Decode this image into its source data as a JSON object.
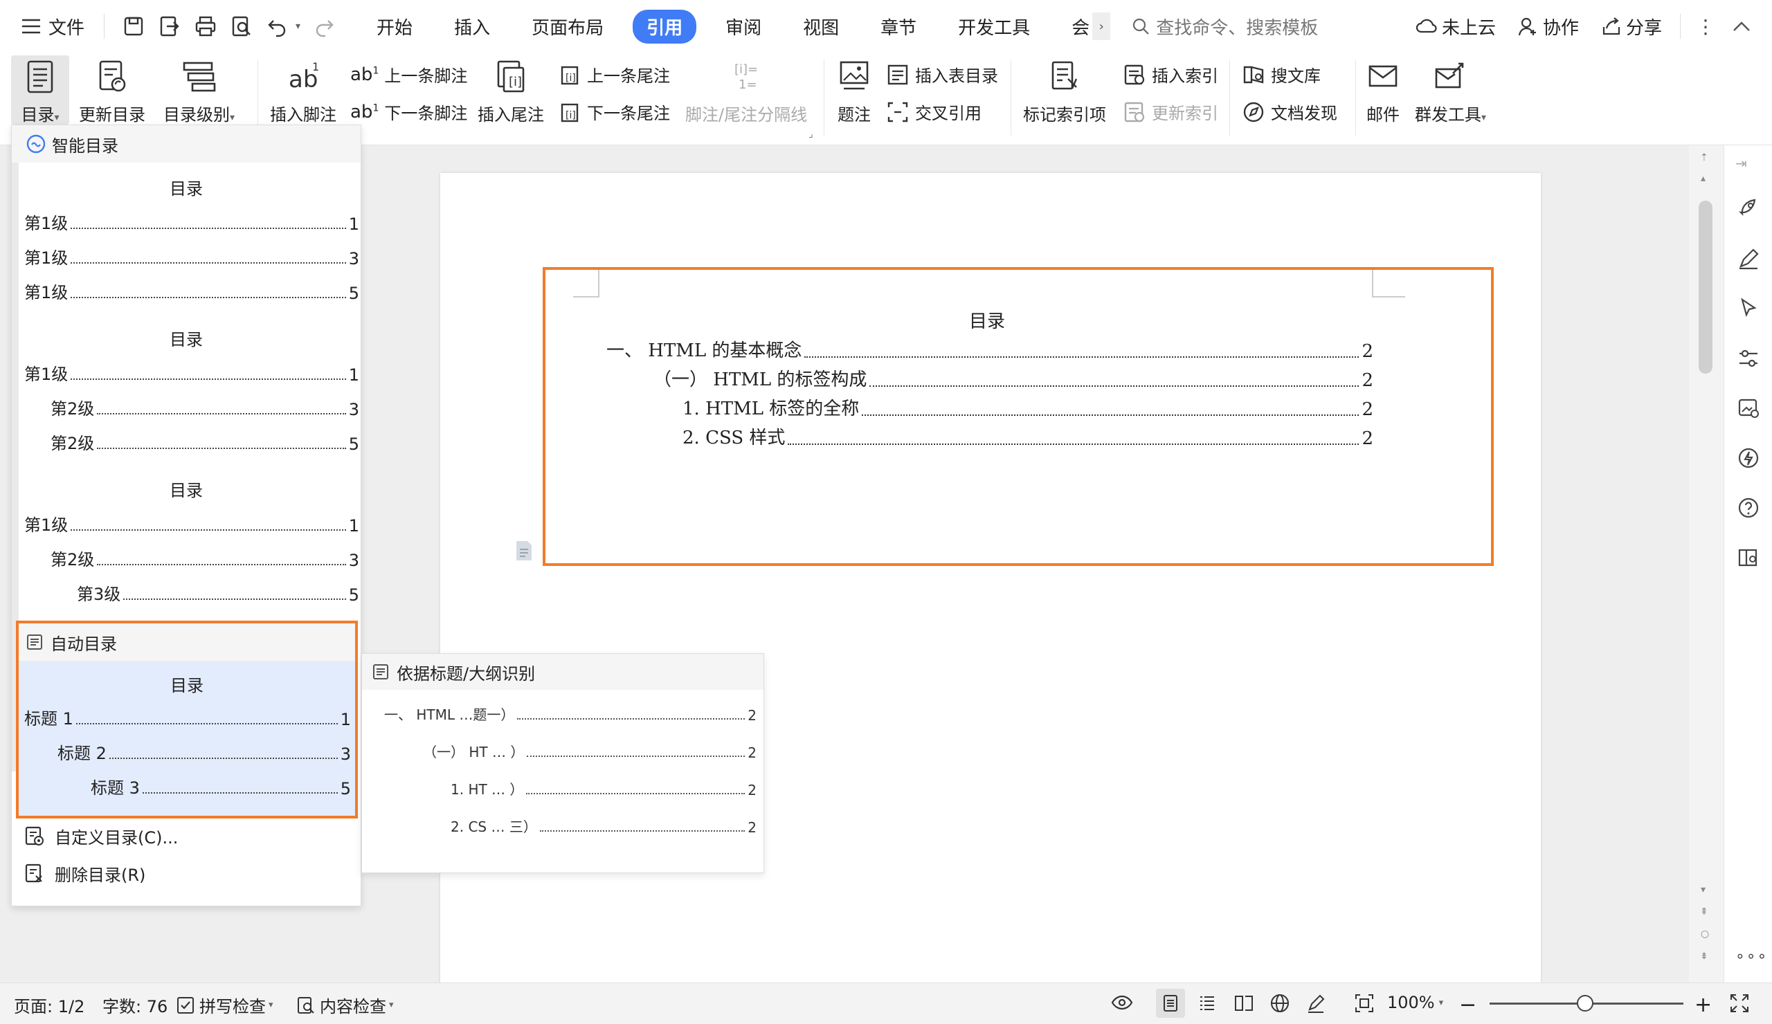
{
  "topbar": {
    "file_label": "文件",
    "tabs": [
      "开始",
      "插入",
      "页面布局",
      "引用",
      "审阅",
      "视图",
      "章节",
      "开发工具",
      "会"
    ],
    "active_tab": "引用",
    "search_placeholder": "查找命令、搜索模板",
    "cloud_label": "未上云",
    "collab_label": "协作",
    "share_label": "分享"
  },
  "ribbon": {
    "toc": "目录",
    "update_toc": "更新目录",
    "toc_level": "目录级别",
    "insert_footnote": "插入脚注",
    "prev_footnote": "上一条脚注",
    "next_footnote": "下一条脚注",
    "insert_endnote": "插入尾注",
    "prev_endnote": "上一条尾注",
    "next_endnote": "下一条尾注",
    "footnote_separator": "脚注/尾注分隔线",
    "caption": "题注",
    "insert_table_toc": "插入表目录",
    "cross_ref": "交叉引用",
    "mark_index": "标记索引项",
    "insert_index": "插入索引",
    "update_index": "更新索引",
    "search_lib": "搜文库",
    "doc_discover": "文档发现",
    "mail": "邮件",
    "group_tools": "群发工具"
  },
  "dropdown": {
    "smart_toc_header": "智能目录",
    "smart_blocks": [
      {
        "title": "目录",
        "rows": [
          {
            "label": "第1级",
            "page": "1",
            "indent": 0
          },
          {
            "label": "第1级",
            "page": "3",
            "indent": 0
          },
          {
            "label": "第1级",
            "page": "5",
            "indent": 0
          }
        ]
      },
      {
        "title": "目录",
        "rows": [
          {
            "label": "第1级",
            "page": "1",
            "indent": 0
          },
          {
            "label": "第2级",
            "page": "3",
            "indent": 1
          },
          {
            "label": "第2级",
            "page": "5",
            "indent": 1
          }
        ]
      },
      {
        "title": "目录",
        "rows": [
          {
            "label": "第1级",
            "page": "1",
            "indent": 0
          },
          {
            "label": "第2级",
            "page": "3",
            "indent": 1
          },
          {
            "label": "第3级",
            "page": "5",
            "indent": 2
          }
        ]
      }
    ],
    "auto_toc_header": "自动目录",
    "auto_block": {
      "title": "目录",
      "rows": [
        {
          "label": "标题 1",
          "page": "1",
          "indent": 0
        },
        {
          "label": "标题 2",
          "page": "3",
          "indent": 1
        },
        {
          "label": "标题 3",
          "page": "5",
          "indent": 2
        }
      ]
    },
    "custom_toc": "自定义目录(C)...",
    "delete_toc": "删除目录(R)"
  },
  "submenu": {
    "header": "依据标题/大纲识别",
    "rows": [
      {
        "label": "一、 HTML …题一）",
        "page": "2"
      },
      {
        "label": "（一） HT … ）",
        "page": "2"
      },
      {
        "label": "1. HT … ）",
        "page": "2"
      },
      {
        "label": "2. CS … 三）",
        "page": "2"
      }
    ]
  },
  "document": {
    "toc_title": "目录",
    "entries": [
      {
        "label": "一、  HTML 的基本概念",
        "page": "2"
      },
      {
        "label": "（一）  HTML 的标签构成",
        "page": "2"
      },
      {
        "label": "1. HTML 标签的全称",
        "page": "2"
      },
      {
        "label": "2. CSS 样式",
        "page": "2"
      }
    ]
  },
  "statusbar": {
    "page": "页面: 1/2",
    "words": "字数: 76",
    "spell": "拼写检查",
    "content_check": "内容检查",
    "zoom": "100%"
  },
  "colors": {
    "accent": "#3f7cf6",
    "highlight_border": "#f27c2b",
    "auto_preview_bg": "#e3ecfd"
  }
}
